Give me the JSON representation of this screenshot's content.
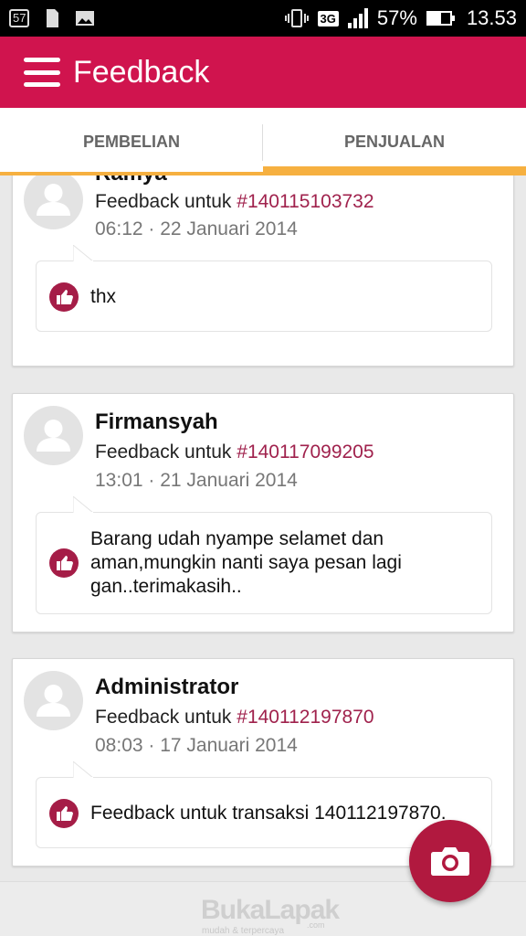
{
  "status_bar": {
    "notif_count": "57",
    "network": "3G",
    "battery": "57%",
    "time": "13.53"
  },
  "appbar": {
    "title": "Feedback"
  },
  "tabs": [
    {
      "label": "PEMBELIAN",
      "active": false
    },
    {
      "label": "PENJUALAN",
      "active": true
    }
  ],
  "feedbacks": [
    {
      "name": "Ramya",
      "prefix": "Feedback untuk ",
      "txn": "#140115103732",
      "time": "06:12 · 22 Januari 2014",
      "message": "thx",
      "rating": "positive"
    },
    {
      "name": "Firmansyah",
      "prefix": "Feedback untuk ",
      "txn": "#140117099205",
      "time": "13:01 · 21 Januari 2014",
      "message": "Barang udah nyampe selamet dan aman,mungkin nanti saya pesan lagi gan..terimakasih..",
      "rating": "positive"
    },
    {
      "name": "Administrator",
      "prefix": "Feedback untuk ",
      "txn": "#140112197870",
      "time": "08:03 · 17 Januari 2014",
      "message": "Feedback untuk transaksi 140112197870.",
      "rating": "positive"
    }
  ],
  "footer": {
    "brand": "BukaLapak",
    "brand_suffix": ".com",
    "tagline": "mudah & terpercaya"
  },
  "icons": {
    "menu": "hamburger-icon",
    "avatar": "user-placeholder-icon",
    "thumb": "thumbs-up-icon",
    "camera": "camera-icon"
  },
  "colors": {
    "primary": "#d0144e",
    "accent": "#f6b040",
    "link": "#a0224d",
    "thumb": "#a51d47",
    "fab": "#b1193f"
  }
}
